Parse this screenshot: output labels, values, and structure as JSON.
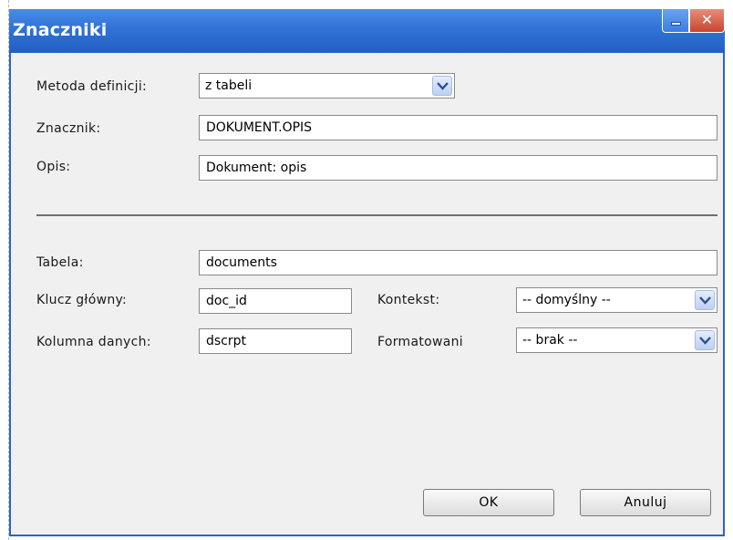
{
  "window": {
    "title": "Znaczniki",
    "minimize_icon": "minimize-icon",
    "close_icon": "close-icon",
    "close_glyph": "✕"
  },
  "form": {
    "metoda": {
      "label": "Metoda definicji:",
      "value": "z tabeli"
    },
    "znacznik": {
      "label": "Znacznik:",
      "value": "DOKUMENT.OPIS"
    },
    "opis": {
      "label": "Opis:",
      "value": "Dokument: opis"
    },
    "tabela": {
      "label": "Tabela:",
      "value": "documents"
    },
    "klucz": {
      "label": "Klucz główny:",
      "value": "doc_id"
    },
    "kolumna": {
      "label": "Kolumna danych:",
      "value": "dscrpt"
    },
    "kontekst": {
      "label": "Kontekst:",
      "value": "-- domyślny --"
    },
    "formatowanie": {
      "label": "Formatowani",
      "value": "-- brak --"
    }
  },
  "buttons": {
    "ok": "OK",
    "cancel": "Anuluj"
  },
  "colors": {
    "titlebar": "#2f72d6",
    "window_bg": "#f0f0f0",
    "close_button": "#c9452f"
  }
}
